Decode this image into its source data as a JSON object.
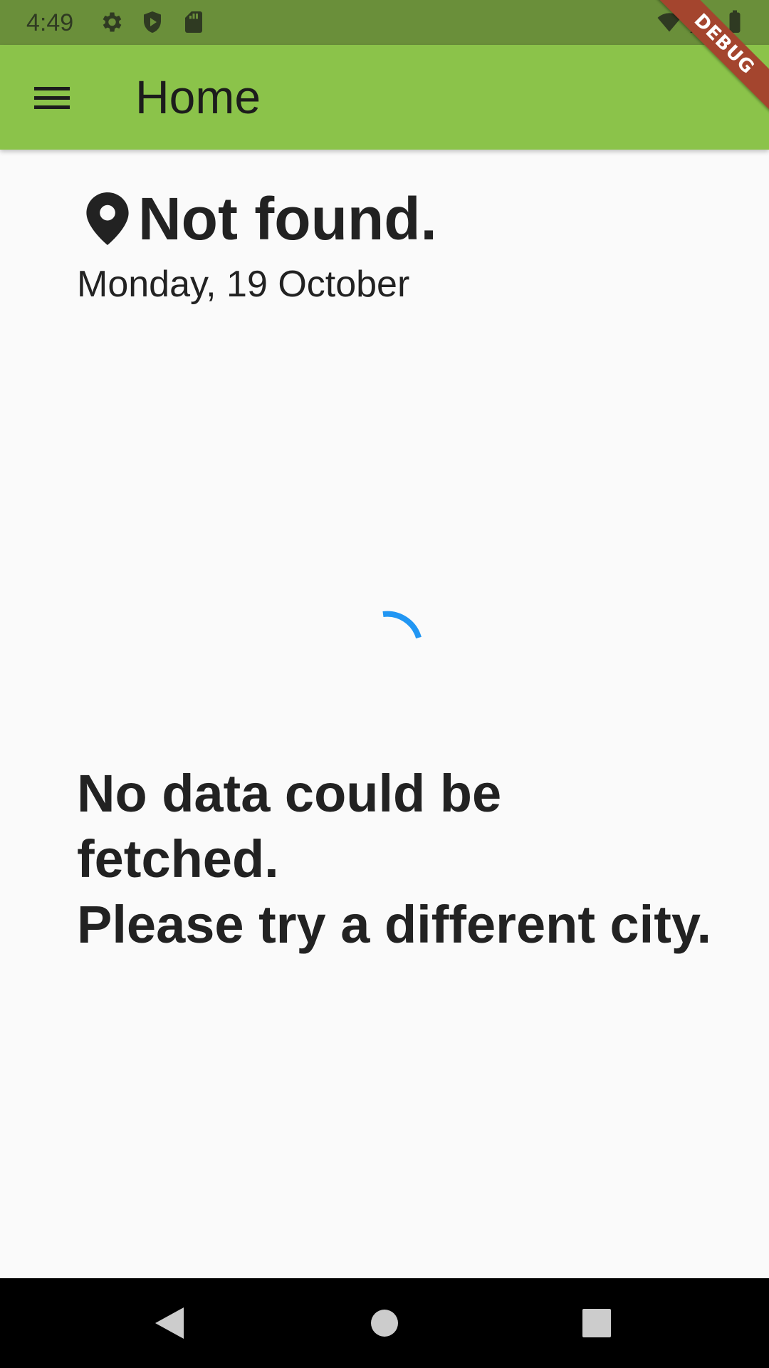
{
  "status_bar": {
    "time": "4:49",
    "icons": [
      "gear-icon",
      "shield-play-icon",
      "sd-card-icon",
      "wifi-icon",
      "signal-icon",
      "battery-icon"
    ]
  },
  "app_bar": {
    "title": "Home",
    "menu_icon": "menu-icon",
    "color": "#8bc34a"
  },
  "debug_banner": {
    "label": "DEBUG"
  },
  "location": {
    "icon": "location-pin-icon",
    "name": "Not found.",
    "date": "Monday, 19 October"
  },
  "loading": {
    "indicator": "circular-progress",
    "color": "#2196f3"
  },
  "message": {
    "text": "No data could be fetched.\nPlease try a different city."
  },
  "nav_bar": {
    "buttons": [
      "back-icon",
      "home-icon",
      "recents-icon"
    ]
  }
}
